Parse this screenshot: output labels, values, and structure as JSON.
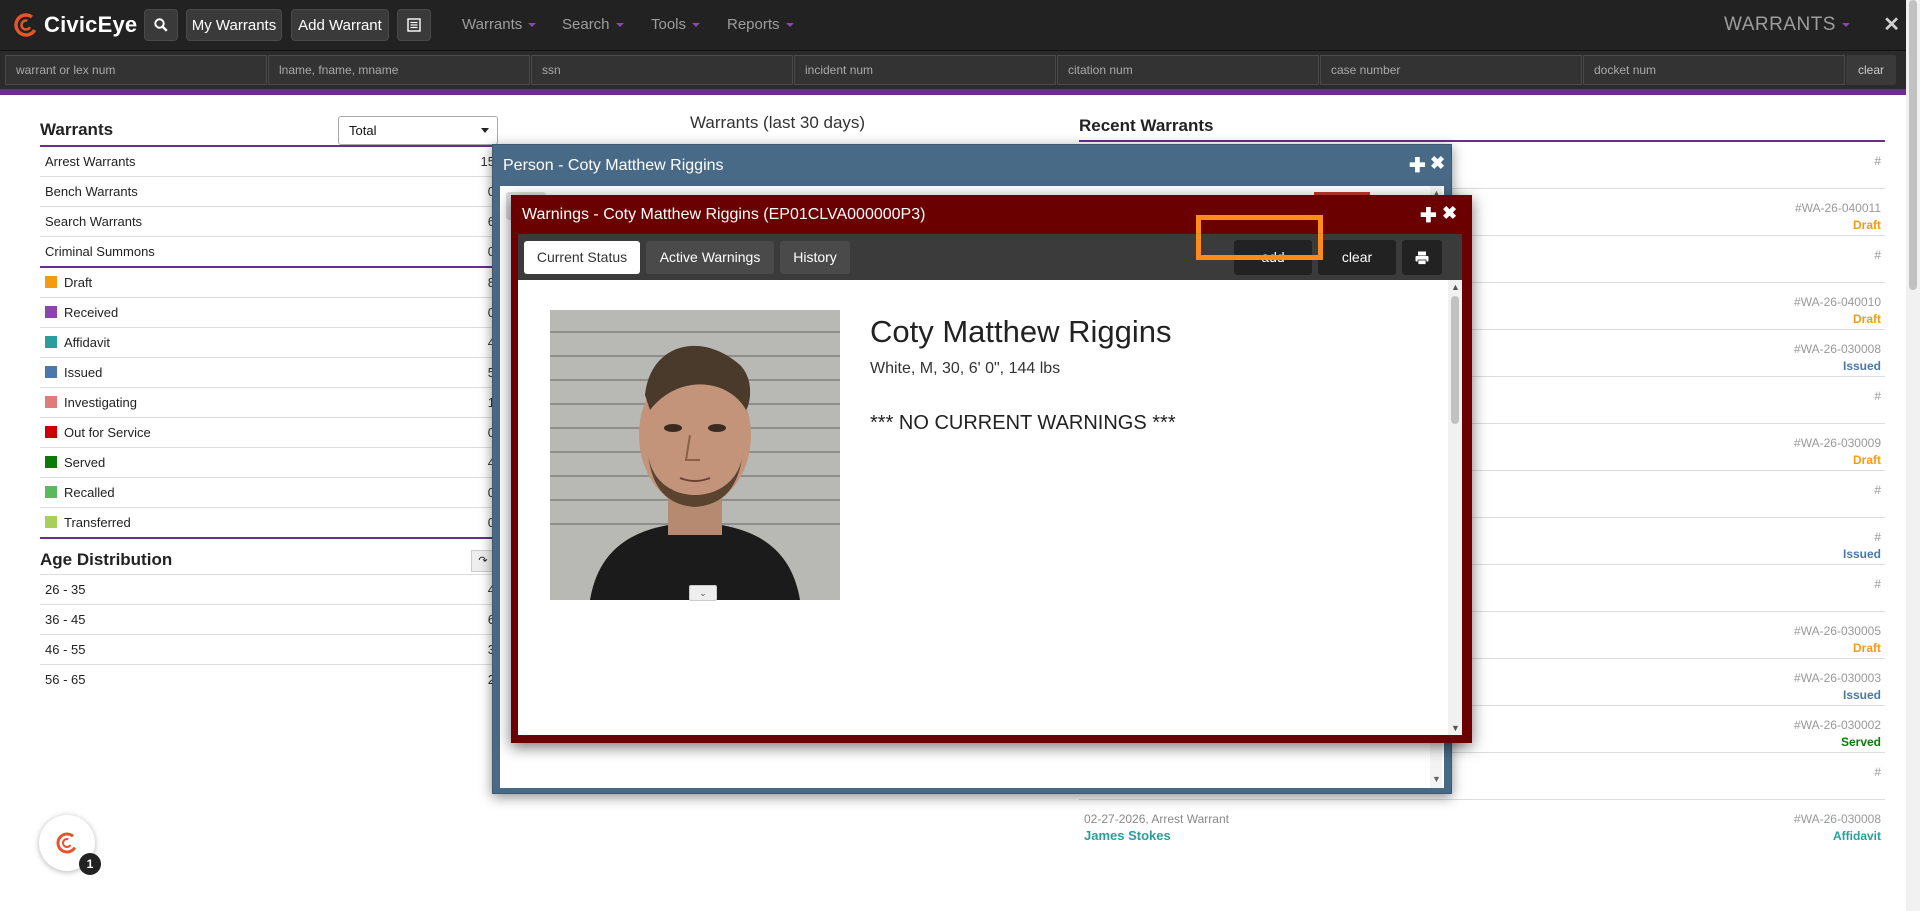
{
  "app": {
    "name": "CivicEye",
    "module_title": "WARRANTS"
  },
  "nav": {
    "my_warrants": "My Warrants",
    "add_warrant": "Add Warrant",
    "menus": [
      "Warrants",
      "Search",
      "Tools",
      "Reports"
    ]
  },
  "search": {
    "placeholders": [
      "warrant or lex num",
      "lname, fname, mname",
      "ssn",
      "incident num",
      "citation num",
      "case number",
      "docket num"
    ],
    "clear": "clear"
  },
  "warrants_panel": {
    "title": "Warrants",
    "select_value": "Total",
    "types": [
      {
        "label": "Arrest Warrants",
        "count": "15"
      },
      {
        "label": "Bench Warrants",
        "count": "0"
      },
      {
        "label": "Search Warrants",
        "count": "6"
      },
      {
        "label": "Criminal Summons",
        "count": "0"
      }
    ],
    "statuses": [
      {
        "label": "Draft",
        "count": "8",
        "color": "#f39c12"
      },
      {
        "label": "Received",
        "count": "0",
        "color": "#8e44ad"
      },
      {
        "label": "Affidavit",
        "count": "4",
        "color": "#2a9d9d"
      },
      {
        "label": "Issued",
        "count": "5",
        "color": "#4a78a8"
      },
      {
        "label": "Investigating",
        "count": "1",
        "color": "#e07b7b"
      },
      {
        "label": "Out for Service",
        "count": "0",
        "color": "#cc0000"
      },
      {
        "label": "Served",
        "count": "4",
        "color": "#0a7a0a"
      },
      {
        "label": "Recalled",
        "count": "0",
        "color": "#5cb85c"
      },
      {
        "label": "Transferred",
        "count": "0",
        "color": "#a6d05a"
      }
    ]
  },
  "age_panel": {
    "title": "Age Distribution",
    "rows": [
      {
        "label": "26 - 35",
        "count": "4"
      },
      {
        "label": "36 - 45",
        "count": "6"
      },
      {
        "label": "46 - 55",
        "count": "3"
      },
      {
        "label": "56 - 65",
        "count": "2"
      }
    ]
  },
  "chart": {
    "title": "Warrants (last 30 days)"
  },
  "recent": {
    "title": "Recent Warrants",
    "items": [
      {
        "num": "#",
        "status": "",
        "status_color": ""
      },
      {
        "num": "#WA-26-040011",
        "status": "Draft",
        "status_color": "#f39c12"
      },
      {
        "num": "#",
        "status": "",
        "status_color": ""
      },
      {
        "num": "#WA-26-040010",
        "status": "Draft",
        "status_color": "#f39c12"
      },
      {
        "num": "#WA-26-030008",
        "status": "Issued",
        "status_color": "#4a78a8"
      },
      {
        "num": "#",
        "status": "",
        "status_color": ""
      },
      {
        "num": "#WA-26-030009",
        "status": "Draft",
        "status_color": "#f39c12"
      },
      {
        "num": "#",
        "status": "",
        "status_color": ""
      },
      {
        "num": "#",
        "status": "Issued",
        "status_color": "#4a78a8"
      },
      {
        "num": "#",
        "status": "",
        "status_color": ""
      },
      {
        "num": "#WA-26-030005",
        "status": "Draft",
        "status_color": "#f39c12"
      },
      {
        "num": "#WA-26-030003",
        "status": "Issued",
        "status_color": "#4a78a8"
      },
      {
        "num": "#WA-26-030002",
        "status": "Served",
        "status_color": "#0a7a0a"
      },
      {
        "num": "#",
        "status": "",
        "status_color": ""
      }
    ],
    "last_item": {
      "meta": "02-27-2026, Arrest Warrant",
      "name": "James Stokes",
      "num": "#WA-26-030008",
      "status": "Affidavit",
      "status_color": "#2a9d9d"
    }
  },
  "notification_count": "1",
  "person_window": {
    "title": "Person - Coty Matthew Riggins"
  },
  "warnings_window": {
    "title": "Warnings - Coty Matthew Riggins (EP01CLVA000000P3)",
    "tabs": [
      "Current Status",
      "Active Warnings",
      "History"
    ],
    "add_label": "add",
    "clear_label": "clear",
    "person_name": "Coty Matthew Riggins",
    "person_desc": "White, M, 30, 6' 0\", 144 lbs",
    "no_warnings": "*** NO CURRENT WARNINGS ***"
  }
}
